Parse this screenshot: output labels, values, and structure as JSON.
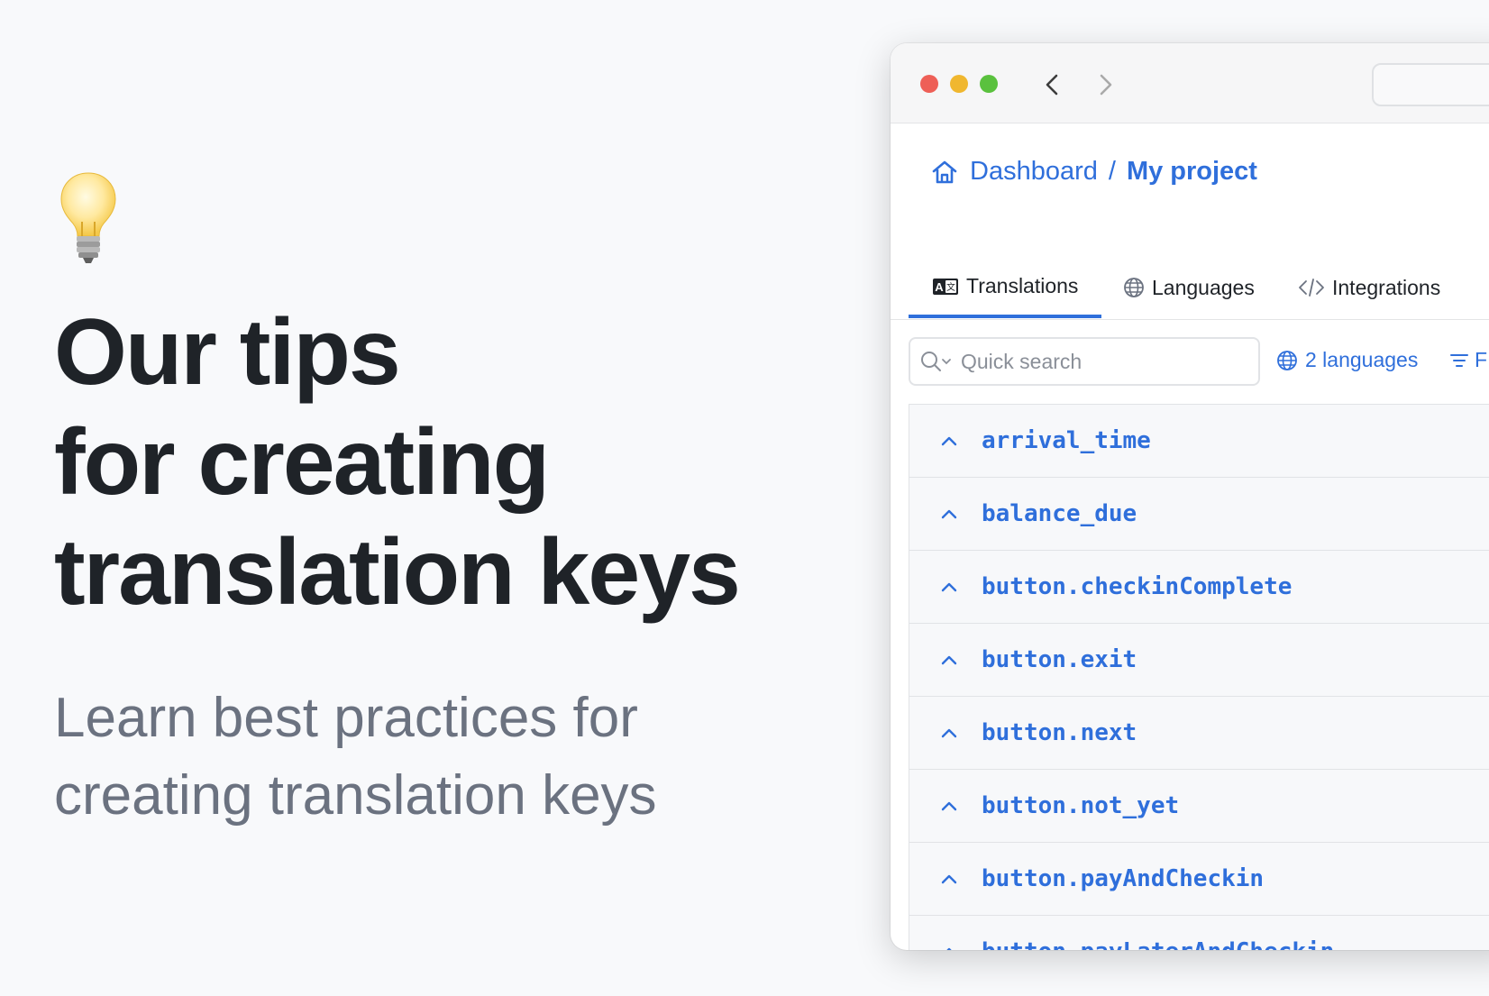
{
  "hero": {
    "title_lines": [
      "Our tips",
      "for creating",
      "translation keys"
    ],
    "subtitle_lines": [
      "Learn best practices for",
      "creating translation keys"
    ],
    "icon": "lightbulb-icon"
  },
  "app": {
    "breadcrumb": {
      "home_label": "Dashboard",
      "separator": "/",
      "project_label": "My project"
    },
    "tabs": [
      {
        "label": "Translations",
        "icon": "translate-icon",
        "active": true
      },
      {
        "label": "Languages",
        "icon": "globe-icon",
        "active": false
      },
      {
        "label": "Integrations",
        "icon": "code-icon",
        "active": false
      }
    ],
    "search": {
      "placeholder": "Quick search",
      "value": ""
    },
    "language_filter": "2 languages",
    "filter_label": "F",
    "keys": [
      "arrival_time",
      "balance_due",
      "button.checkinComplete",
      "button.exit",
      "button.next",
      "button.not_yet",
      "button.payAndCheckin",
      "button.payLaterAndCheckin"
    ]
  },
  "colors": {
    "accent": "#2f6fdb",
    "title": "#1f2328",
    "subtitle": "#6b7280",
    "background": "#f8f9fb"
  }
}
